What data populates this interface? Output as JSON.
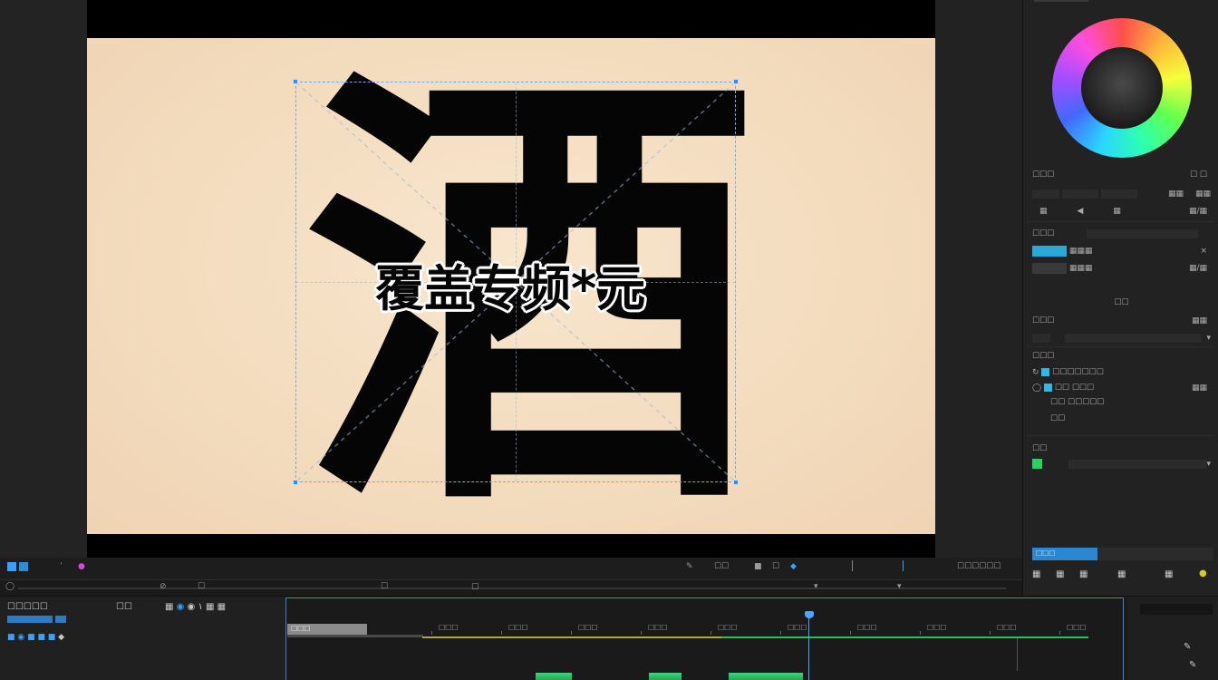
{
  "monitor": {
    "glyph": "酒",
    "overlay_text": "覆盖专频*元",
    "controls_left": [
      "☷ ☐",
      "●"
    ],
    "controls_mid": [
      "⊘",
      "☐",
      "☐",
      "▢"
    ],
    "controls_right": [
      "✎",
      "☐☐",
      "■",
      "☐",
      "◆"
    ],
    "timecode_right": "☐☐☐☐☐☐"
  },
  "right_panel": {
    "section1_title": "☐☐☐",
    "section1_right": "☐ ☐",
    "row1": "☐☐ ☐ ☐",
    "row2": "◀",
    "section2_title": "☐☐☐",
    "section3_label": "☐☐",
    "section4_title": "☐☐☐",
    "section5_title": "☐☐☐",
    "item1": "☐☐☐☐☐☐☐",
    "item2": "☐☐ ☐☐☐",
    "item3": "☐☐ ☐☐☐☐☐",
    "item4": "☐☐",
    "section6_title": "☐☐",
    "progress": 0.36,
    "progress_label": "☐☐☐"
  },
  "timeline": {
    "header_title": "☐☐☐☐☐",
    "header_tools": "☐☐",
    "ruler_labels": [
      "☐☐☐",
      "☐☐☐",
      "☐☐☐",
      "☐☐☐",
      "☐☐☐",
      "☐☐☐",
      "☐☐☐",
      "☐☐☐",
      "☐☐☐",
      "☐☐☐",
      "☐☐☐",
      "☐☐☐"
    ],
    "clip_label": "☐☐☐"
  },
  "colors": {
    "accent": "#3aa0ff",
    "canvas": "#f6e2c7",
    "wave": "#2fbf4f"
  }
}
